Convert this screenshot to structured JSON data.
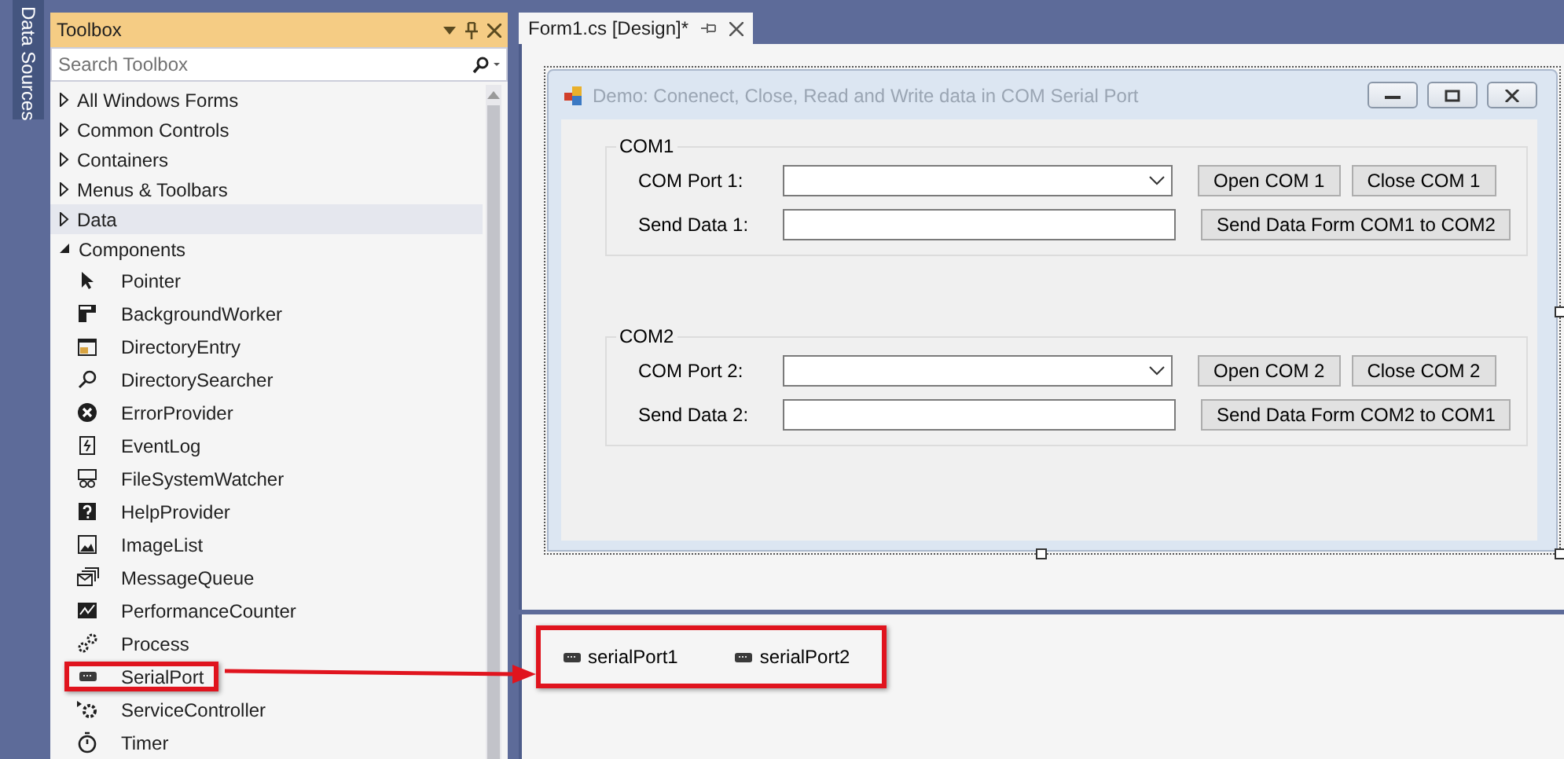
{
  "side_tab": {
    "label": "Data Sources"
  },
  "toolbox": {
    "title": "Toolbox",
    "search": {
      "placeholder": "Search Toolbox"
    },
    "categories": [
      {
        "label": "All Windows Forms",
        "expanded": false,
        "hovered": false
      },
      {
        "label": "Common Controls",
        "expanded": false,
        "hovered": false
      },
      {
        "label": "Containers",
        "expanded": false,
        "hovered": false
      },
      {
        "label": "Menus & Toolbars",
        "expanded": false,
        "hovered": false
      },
      {
        "label": "Data",
        "expanded": false,
        "hovered": true
      },
      {
        "label": "Components",
        "expanded": true,
        "hovered": false,
        "children": [
          {
            "label": "Pointer",
            "highlighted": false
          },
          {
            "label": "BackgroundWorker",
            "highlighted": false
          },
          {
            "label": "DirectoryEntry",
            "highlighted": false
          },
          {
            "label": "DirectorySearcher",
            "highlighted": false
          },
          {
            "label": "ErrorProvider",
            "highlighted": false
          },
          {
            "label": "EventLog",
            "highlighted": false
          },
          {
            "label": "FileSystemWatcher",
            "highlighted": false
          },
          {
            "label": "HelpProvider",
            "highlighted": false
          },
          {
            "label": "ImageList",
            "highlighted": false
          },
          {
            "label": "MessageQueue",
            "highlighted": false
          },
          {
            "label": "PerformanceCounter",
            "highlighted": false
          },
          {
            "label": "Process",
            "highlighted": false
          },
          {
            "label": "SerialPort",
            "highlighted": true
          },
          {
            "label": "ServiceController",
            "highlighted": false
          },
          {
            "label": "Timer",
            "highlighted": false
          }
        ]
      }
    ]
  },
  "tabs": [
    {
      "label": "Form1.cs [Design]*",
      "selected": true
    }
  ],
  "form": {
    "title": "Demo: Conenect, Close, Read and Write data in COM Serial Port",
    "groups": [
      {
        "title": "COM1",
        "rows": [
          {
            "label": "COM Port 1:",
            "kind": "combo",
            "buttons": [
              "Open COM 1",
              "Close COM 1"
            ]
          },
          {
            "label": "Send Data 1:",
            "kind": "text",
            "buttons": [
              "Send Data Form COM1 to COM2"
            ]
          }
        ]
      },
      {
        "title": "COM2",
        "rows": [
          {
            "label": "COM Port 2:",
            "kind": "combo",
            "buttons": [
              "Open COM 2",
              "Close COM 2"
            ]
          },
          {
            "label": "Send Data 2:",
            "kind": "text",
            "buttons": [
              "Send Data Form COM2 to COM1"
            ]
          }
        ]
      }
    ]
  },
  "tray": {
    "highlighted": true,
    "items": [
      {
        "label": "serialPort1"
      },
      {
        "label": "serialPort2"
      }
    ]
  }
}
